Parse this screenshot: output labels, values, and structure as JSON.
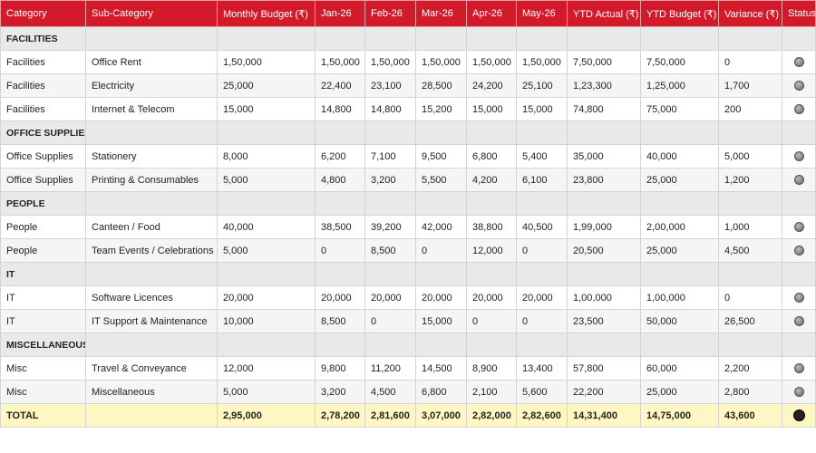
{
  "header": {
    "category": "Category",
    "sub_category": "Sub-Category",
    "monthly_budget": "Monthly Budget (₹)",
    "jan": "Jan-26",
    "feb": "Feb-26",
    "mar": "Mar-26",
    "apr": "Apr-26",
    "may": "May-26",
    "ytd_actual": "YTD Actual (₹)",
    "ytd_budget": "YTD Budget (₹)",
    "variance": "Variance (₹)",
    "status": "Status"
  },
  "groups": {
    "facilities": "FACILITIES",
    "office_supplies": "OFFICE SUPPLIES",
    "people": "PEOPLE",
    "it": "IT",
    "misc": "MISCELLANEOUS"
  },
  "rows": [
    {
      "cat": "Facilities",
      "sub": "Office Rent",
      "budget": "1,50,000",
      "jan": "1,50,000",
      "feb": "1,50,000",
      "mar": "1,50,000",
      "apr": "1,50,000",
      "may": "1,50,000",
      "ytd_actual": "7,50,000",
      "ytd_budget": "7,50,000",
      "variance": "0"
    },
    {
      "cat": "Facilities",
      "sub": "Electricity",
      "budget": "25,000",
      "jan": "22,400",
      "feb": "23,100",
      "mar": "28,500",
      "apr": "24,200",
      "may": "25,100",
      "ytd_actual": "1,23,300",
      "ytd_budget": "1,25,000",
      "variance": "1,700"
    },
    {
      "cat": "Facilities",
      "sub": "Internet & Telecom",
      "budget": "15,000",
      "jan": "14,800",
      "feb": "14,800",
      "mar": "15,200",
      "apr": "15,000",
      "may": "15,000",
      "ytd_actual": "74,800",
      "ytd_budget": "75,000",
      "variance": "200"
    },
    {
      "cat": "Office Supplies",
      "sub": "Stationery",
      "budget": "8,000",
      "jan": "6,200",
      "feb": "7,100",
      "mar": "9,500",
      "apr": "6,800",
      "may": "5,400",
      "ytd_actual": "35,000",
      "ytd_budget": "40,000",
      "variance": "5,000"
    },
    {
      "cat": "Office Supplies",
      "sub": "Printing & Consumables",
      "budget": "5,000",
      "jan": "4,800",
      "feb": "3,200",
      "mar": "5,500",
      "apr": "4,200",
      "may": "6,100",
      "ytd_actual": "23,800",
      "ytd_budget": "25,000",
      "variance": "1,200"
    },
    {
      "cat": "People",
      "sub": "Canteen / Food",
      "budget": "40,000",
      "jan": "38,500",
      "feb": "39,200",
      "mar": "42,000",
      "apr": "38,800",
      "may": "40,500",
      "ytd_actual": "1,99,000",
      "ytd_budget": "2,00,000",
      "variance": "1,000"
    },
    {
      "cat": "People",
      "sub": "Team Events / Celebrations",
      "budget": "5,000",
      "jan": "0",
      "feb": "8,500",
      "mar": "0",
      "apr": "12,000",
      "may": "0",
      "ytd_actual": "20,500",
      "ytd_budget": "25,000",
      "variance": "4,500"
    },
    {
      "cat": "IT",
      "sub": "Software Licences",
      "budget": "20,000",
      "jan": "20,000",
      "feb": "20,000",
      "mar": "20,000",
      "apr": "20,000",
      "may": "20,000",
      "ytd_actual": "1,00,000",
      "ytd_budget": "1,00,000",
      "variance": "0"
    },
    {
      "cat": "IT",
      "sub": "IT Support & Maintenance",
      "budget": "10,000",
      "jan": "8,500",
      "feb": "0",
      "mar": "15,000",
      "apr": "0",
      "may": "0",
      "ytd_actual": "23,500",
      "ytd_budget": "50,000",
      "variance": "26,500"
    },
    {
      "cat": "Misc",
      "sub": "Travel & Conveyance",
      "budget": "12,000",
      "jan": "9,800",
      "feb": "11,200",
      "mar": "14,500",
      "apr": "8,900",
      "may": "13,400",
      "ytd_actual": "57,800",
      "ytd_budget": "60,000",
      "variance": "2,200"
    },
    {
      "cat": "Misc",
      "sub": "Miscellaneous",
      "budget": "5,000",
      "jan": "3,200",
      "feb": "4,500",
      "mar": "6,800",
      "apr": "2,100",
      "may": "5,600",
      "ytd_actual": "22,200",
      "ytd_budget": "25,000",
      "variance": "2,800"
    }
  ],
  "total": {
    "label": "TOTAL",
    "budget": "2,95,000",
    "jan": "2,78,200",
    "feb": "2,81,600",
    "mar": "3,07,000",
    "apr": "2,82,000",
    "may": "2,82,600",
    "ytd_actual": "14,31,400",
    "ytd_budget": "14,75,000",
    "variance": "43,600"
  },
  "colors": {
    "header_bg": "#d21a2b",
    "group_bg": "#e9e9e9",
    "total_bg": "#fdf7c4",
    "status_dot": "grey-circle-icon",
    "total_status_dot": "black-circle-icon"
  }
}
